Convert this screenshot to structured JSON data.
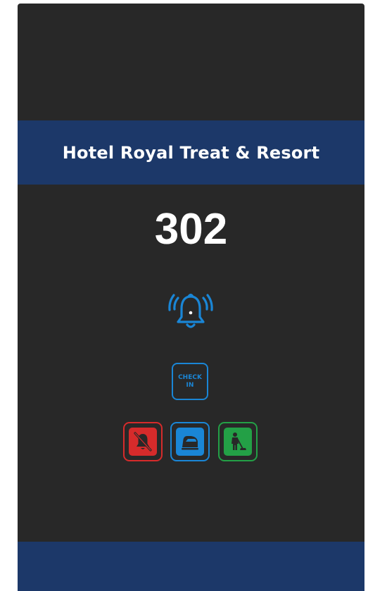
{
  "hotel": {
    "name": "Hotel Royal Treat & Resort"
  },
  "room": {
    "number": "302"
  },
  "buttons": {
    "call": {
      "icon": "ringing-bell-icon"
    },
    "check_in": {
      "line1": "CHECK",
      "line2": "IN"
    },
    "do_not_disturb": {
      "icon": "muted-bell-icon"
    },
    "laundry": {
      "icon": "iron-icon"
    },
    "housekeeping": {
      "icon": "cleaner-sweeping-icon"
    }
  },
  "colors": {
    "panel": "#282828",
    "band": "#1c3869",
    "call_blue": "#1a86d6",
    "dnd_red": "#d62b2b",
    "housekeeping_green": "#23a046",
    "text": "#ffffff"
  }
}
